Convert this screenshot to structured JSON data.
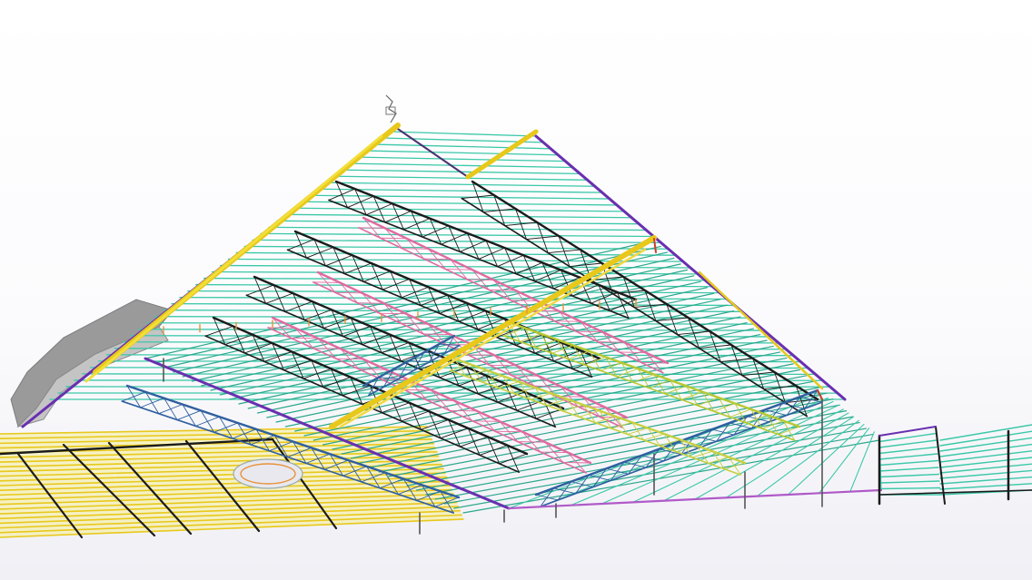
{
  "viewport": {
    "background_top": "#ffffff",
    "background_bottom": "#eeeef3"
  },
  "model": {
    "description_icon": "steel-roof-structure-3d",
    "colors": {
      "purlin": "#3cc8a8",
      "purlin_dark": "#2aa88c",
      "ridge_beam": "#6a2fb0",
      "main_truss": "#1b1b1b",
      "yellow_beam": "#e8c81a",
      "yellow_light": "#f2df3a",
      "blue_truss": "#2f5f9f",
      "pink_member": "#e06aa0",
      "orange_member": "#e8913a",
      "red_member": "#d03a2a",
      "grey_duct": "#9a9a9a"
    }
  }
}
